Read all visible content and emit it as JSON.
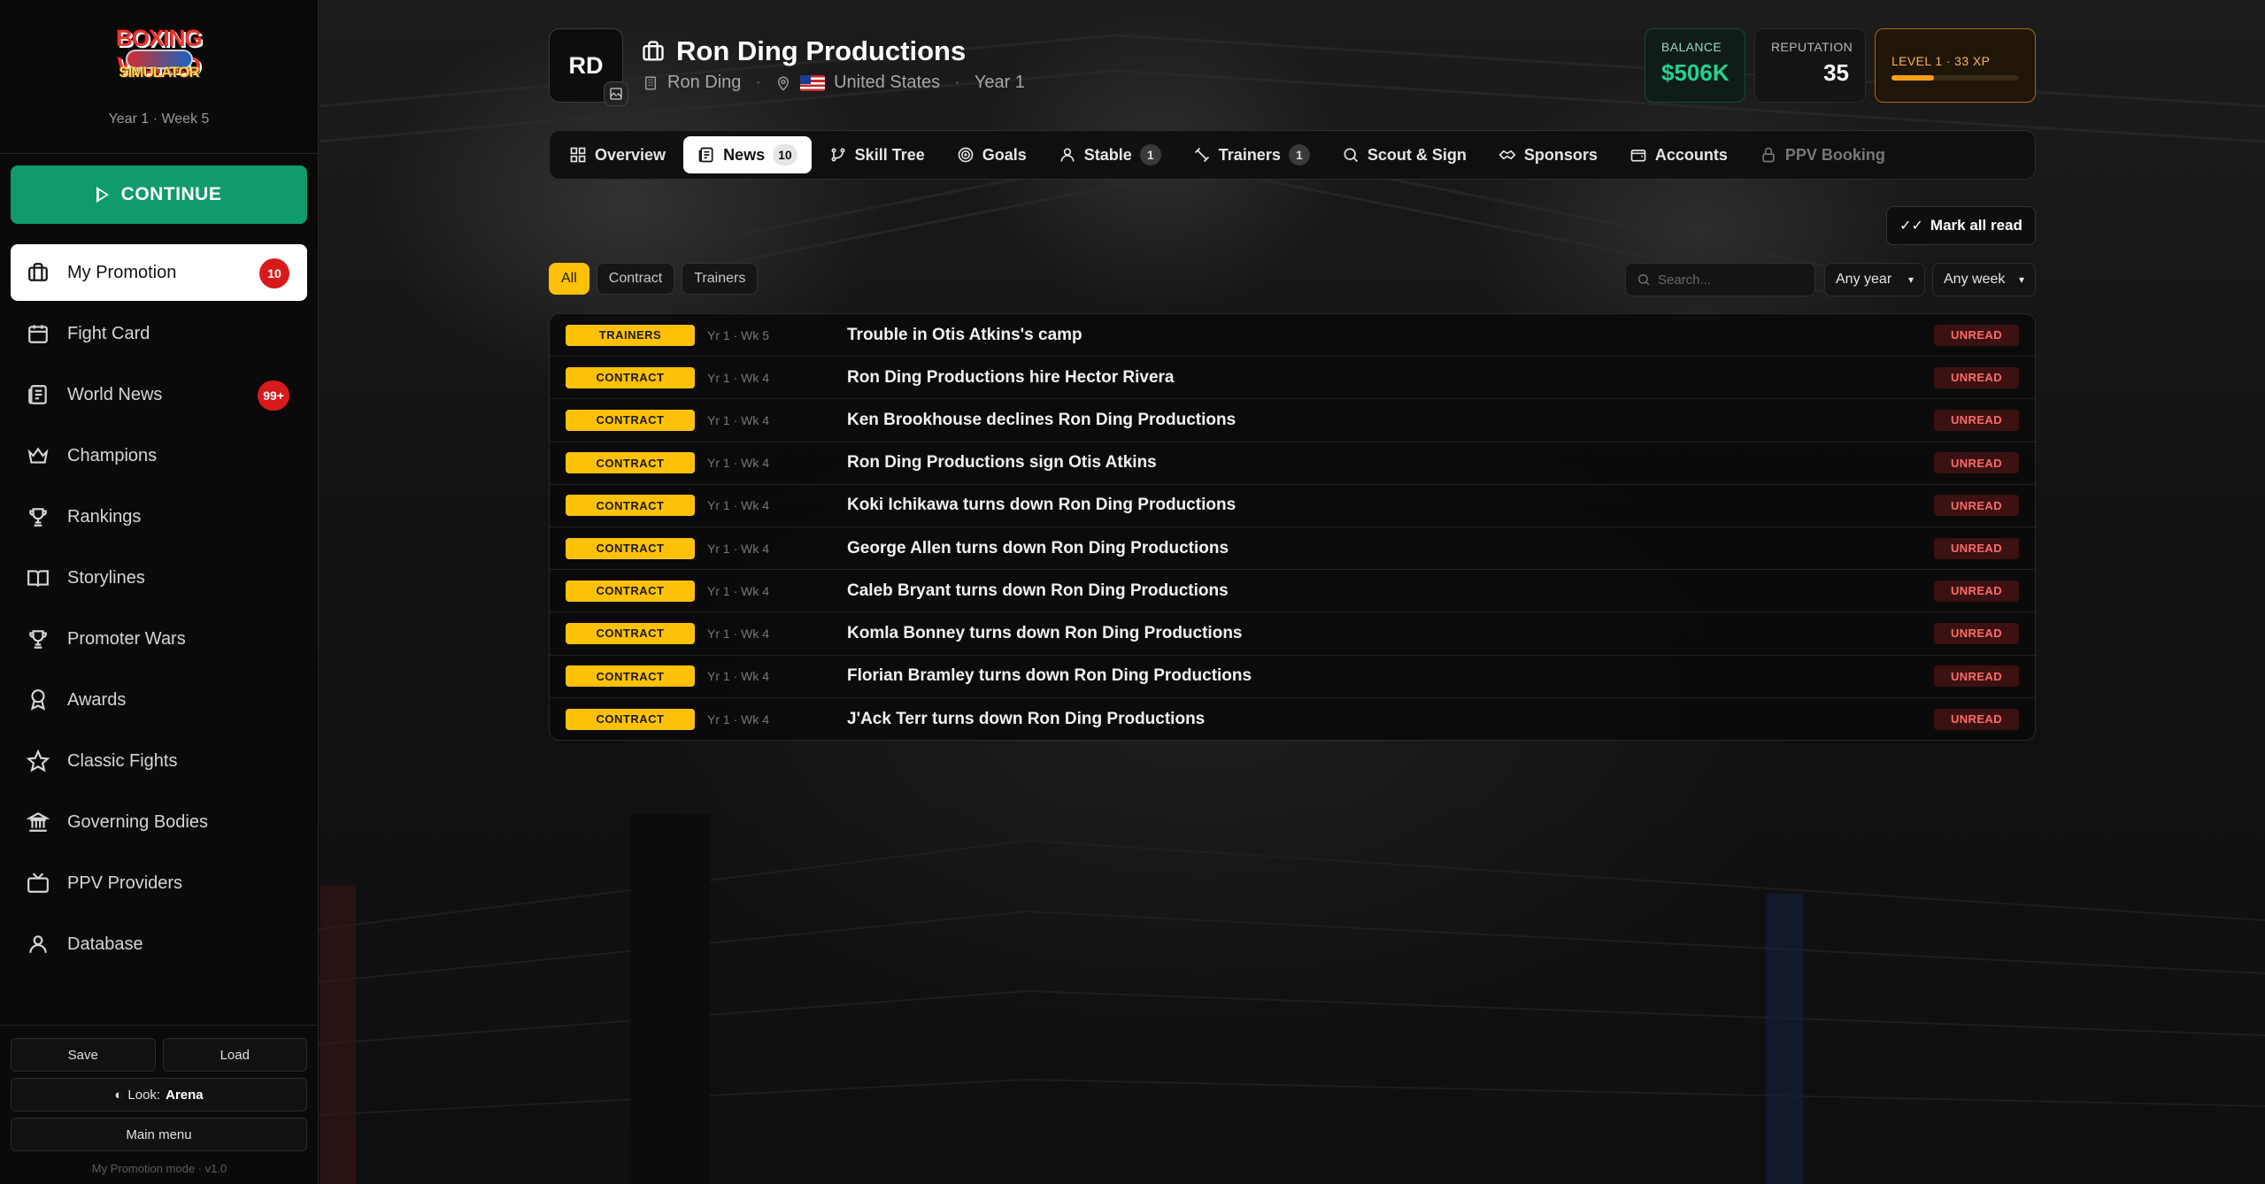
{
  "sidebar": {
    "logo_line1": "BOXING WORLD",
    "logo_line2": "SIMULATOR",
    "week": "Year 1 · Week 5",
    "continue_label": "CONTINUE",
    "items": [
      {
        "label": "My Promotion",
        "icon": "briefcase-icon",
        "badge": "10"
      },
      {
        "label": "Fight Card",
        "icon": "calendar-icon",
        "badge": ""
      },
      {
        "label": "World News",
        "icon": "newspaper-icon",
        "badge": "99+"
      },
      {
        "label": "Champions",
        "icon": "crown-icon",
        "badge": ""
      },
      {
        "label": "Rankings",
        "icon": "trophy-icon",
        "badge": ""
      },
      {
        "label": "Storylines",
        "icon": "book-icon",
        "badge": ""
      },
      {
        "label": "Promoter Wars",
        "icon": "trophy-icon",
        "badge": ""
      },
      {
        "label": "Awards",
        "icon": "award-icon",
        "badge": ""
      },
      {
        "label": "Classic Fights",
        "icon": "star-icon",
        "badge": ""
      },
      {
        "label": "Governing Bodies",
        "icon": "landmark-icon",
        "badge": ""
      },
      {
        "label": "PPV Providers",
        "icon": "tv-icon",
        "badge": ""
      },
      {
        "label": "Database",
        "icon": "users-icon",
        "badge": ""
      }
    ],
    "save_label": "Save",
    "load_label": "Load",
    "look_label": "Look:",
    "look_value": "Arena",
    "main_menu_label": "Main menu",
    "mode_text": "My Promotion mode · v1.0"
  },
  "header": {
    "avatar_initials": "RD",
    "title": "Ron Ding Productions",
    "owner": "Ron Ding",
    "country": "United States",
    "year": "Year 1",
    "balance_label": "BALANCE",
    "balance_value": "$506K",
    "reputation_label": "REPUTATION",
    "reputation_value": "35",
    "level_label": "LEVEL 1 · 33 XP",
    "xp_progress": 0.33
  },
  "tabs": [
    {
      "label": "Overview",
      "icon": "grid-icon",
      "count": ""
    },
    {
      "label": "News",
      "icon": "newspaper-icon",
      "count": "10"
    },
    {
      "label": "Skill Tree",
      "icon": "git-branch-icon",
      "count": ""
    },
    {
      "label": "Goals",
      "icon": "target-icon",
      "count": ""
    },
    {
      "label": "Stable",
      "icon": "user-icon",
      "count": "1"
    },
    {
      "label": "Trainers",
      "icon": "dumbbell-icon",
      "count": "1"
    },
    {
      "label": "Scout & Sign",
      "icon": "search-icon",
      "count": ""
    },
    {
      "label": "Sponsors",
      "icon": "handshake-icon",
      "count": ""
    },
    {
      "label": "Accounts",
      "icon": "wallet-icon",
      "count": ""
    },
    {
      "label": "PPV Booking",
      "icon": "lock-icon",
      "count": ""
    }
  ],
  "filters": {
    "mark_all_read": "Mark all read",
    "chips": [
      "All",
      "Contract",
      "Trainers"
    ],
    "search_placeholder": "Search...",
    "year_select": "Any year",
    "week_select": "Any week"
  },
  "news": [
    {
      "category": "TRAINERS",
      "when": "Yr 1 · Wk 5",
      "headline": "Trouble in Otis Atkins's camp",
      "status": "UNREAD"
    },
    {
      "category": "CONTRACT",
      "when": "Yr 1 · Wk 4",
      "headline": "Ron Ding Productions hire Hector Rivera",
      "status": "UNREAD"
    },
    {
      "category": "CONTRACT",
      "when": "Yr 1 · Wk 4",
      "headline": "Ken Brookhouse declines Ron Ding Productions",
      "status": "UNREAD"
    },
    {
      "category": "CONTRACT",
      "when": "Yr 1 · Wk 4",
      "headline": "Ron Ding Productions sign Otis Atkins",
      "status": "UNREAD"
    },
    {
      "category": "CONTRACT",
      "when": "Yr 1 · Wk 4",
      "headline": "Koki Ichikawa turns down Ron Ding Productions",
      "status": "UNREAD"
    },
    {
      "category": "CONTRACT",
      "when": "Yr 1 · Wk 4",
      "headline": "George Allen turns down Ron Ding Productions",
      "status": "UNREAD"
    },
    {
      "category": "CONTRACT",
      "when": "Yr 1 · Wk 4",
      "headline": "Caleb Bryant turns down Ron Ding Productions",
      "status": "UNREAD"
    },
    {
      "category": "CONTRACT",
      "when": "Yr 1 · Wk 4",
      "headline": "Komla Bonney turns down Ron Ding Productions",
      "status": "UNREAD"
    },
    {
      "category": "CONTRACT",
      "when": "Yr 1 · Wk 4",
      "headline": "Florian Bramley turns down Ron Ding Productions",
      "status": "UNREAD"
    },
    {
      "category": "CONTRACT",
      "when": "Yr 1 · Wk 4",
      "headline": "J'Ack Terr turns down Ron Ding Productions",
      "status": "UNREAD"
    }
  ],
  "colors": {
    "accent_green": "#0f9b6c",
    "balance_green": "#24d38e",
    "category_yellow": "#ffc107",
    "badge_red": "#d71a1a",
    "unread_red": "#ff6a6a",
    "level_orange": "#ff9f1a"
  }
}
